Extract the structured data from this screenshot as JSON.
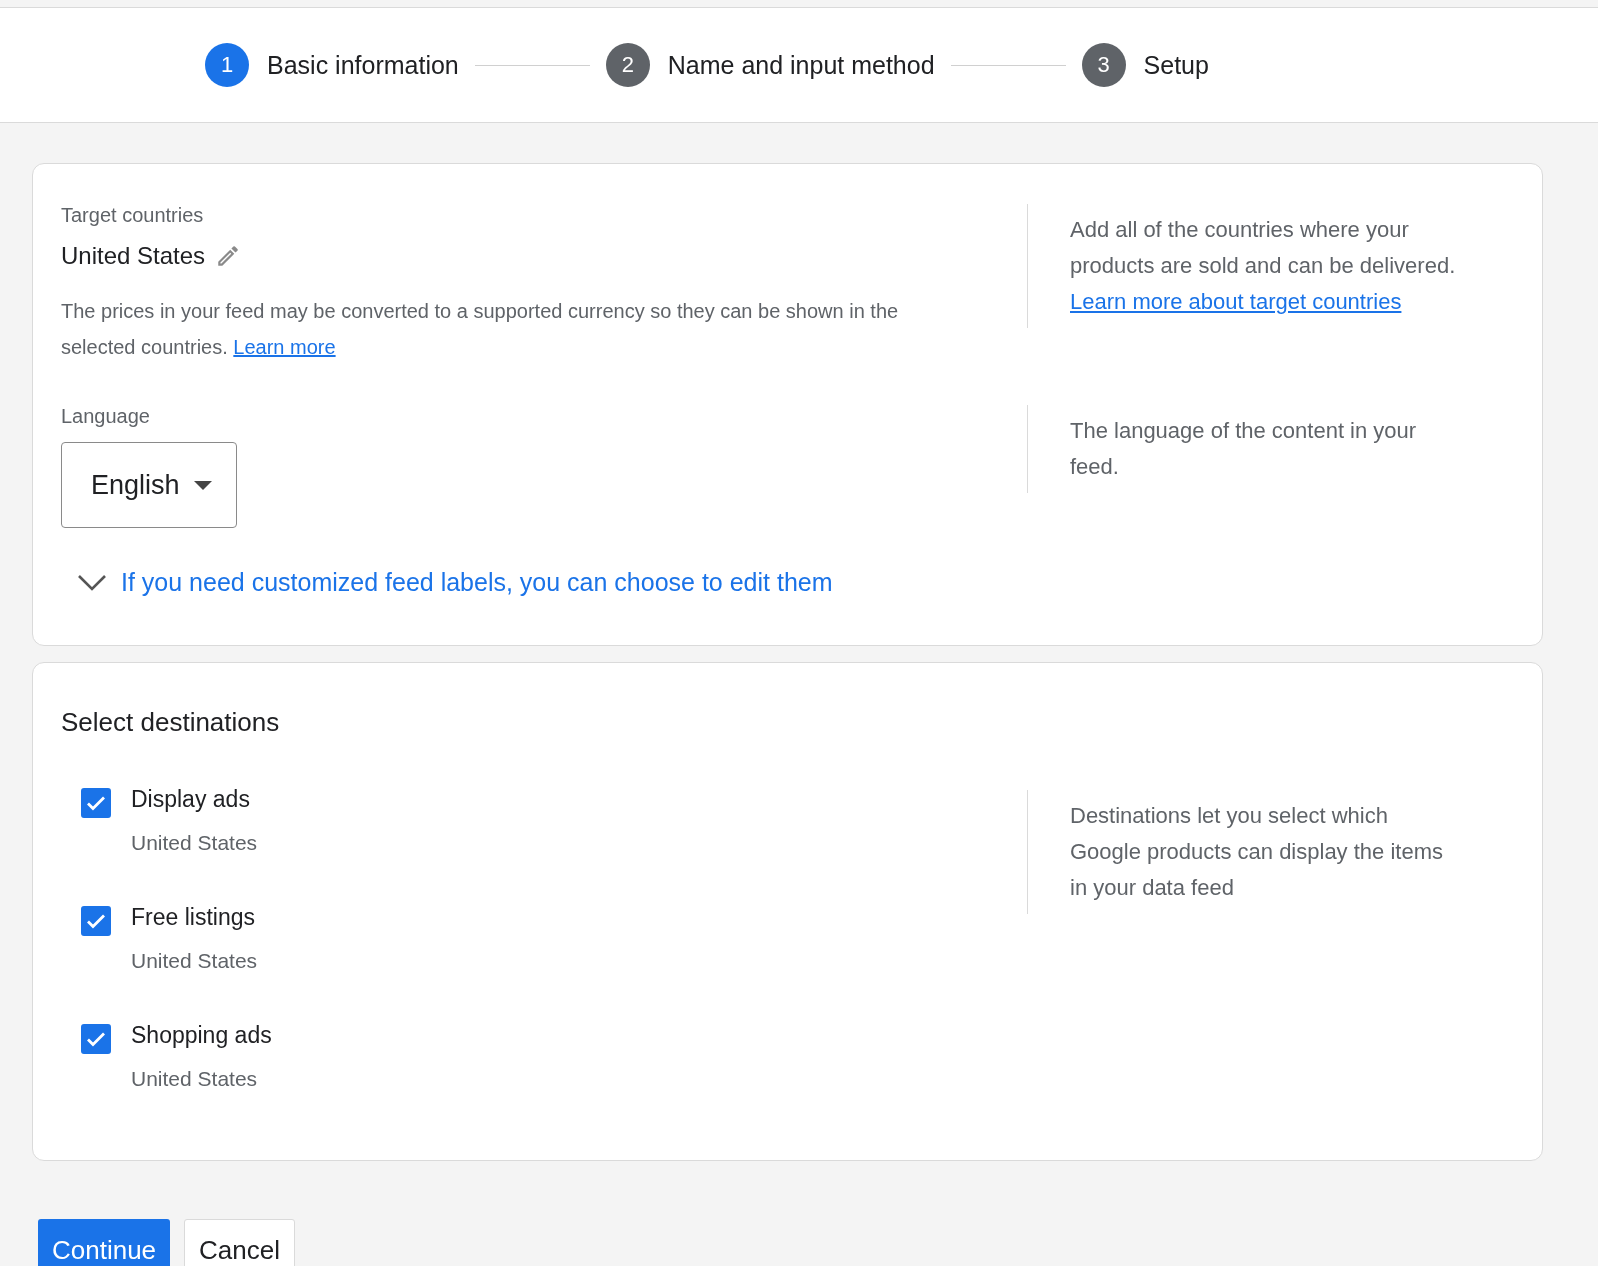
{
  "steps": [
    {
      "number": "1",
      "label": "Basic information",
      "selected": true
    },
    {
      "number": "2",
      "label": "Name and input method",
      "selected": false
    },
    {
      "number": "3",
      "label": "Setup",
      "selected": false
    }
  ],
  "target_countries": {
    "label": "Target countries",
    "value": "United States",
    "note": "The prices in your feed may be converted to a supported currency so they can be shown in the selected countries.",
    "note_link": "Learn more",
    "help": "Add all of the countries where your products are sold and can be delivered.",
    "help_link": "Learn more about target countries"
  },
  "language": {
    "label": "Language",
    "value": "English",
    "help": "The language of the content in your feed."
  },
  "feed_labels": {
    "text": "If you need customized feed labels, you can choose to edit them",
    "expanded": false
  },
  "destinations": {
    "title": "Select destinations",
    "help": "Destinations let you select which Google products can display the items in your data feed",
    "items": [
      {
        "name": "Display ads",
        "country": "United States",
        "checked": true
      },
      {
        "name": "Free listings",
        "country": "United States",
        "checked": true
      },
      {
        "name": "Shopping ads",
        "country": "United States",
        "checked": true
      }
    ]
  },
  "buttons": [
    {
      "label": "Continue",
      "kind": "primary"
    },
    {
      "label": "Cancel",
      "kind": "secondary"
    }
  ]
}
